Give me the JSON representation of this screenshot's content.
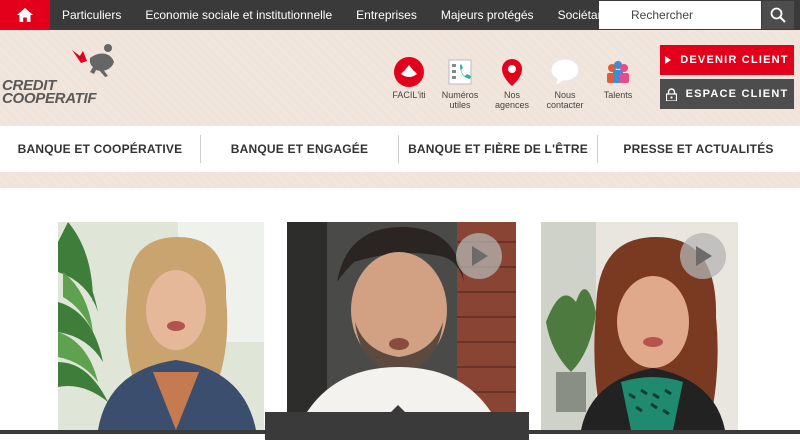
{
  "topbar": {
    "home_icon": "home-icon",
    "nav": [
      "Particuliers",
      "Economie sociale et institutionnelle",
      "Entreprises",
      "Majeurs protégés",
      "Sociétariat"
    ],
    "search_placeholder": "Rechercher",
    "search_icon": "search-icon"
  },
  "brand": {
    "logo_line1": "CREDIT",
    "logo_line2": "COOPERATIF",
    "color": "#e2001a"
  },
  "tools": [
    {
      "label": "FACIL'iti",
      "icon": "faciliti-icon"
    },
    {
      "label": "Numéros utiles",
      "line1": "Numéros",
      "line2": "utiles",
      "icon": "phone-list-icon"
    },
    {
      "label": "Nos agences",
      "line1": "Nos",
      "line2": "agences",
      "icon": "map-pin-icon"
    },
    {
      "label": "Nous contacter",
      "line1": "Nous",
      "line2": "contacter",
      "icon": "chat-bubble-icon"
    },
    {
      "label": "Talents",
      "icon": "people-icon"
    }
  ],
  "cta": {
    "become_client": "DEVENIR CLIENT",
    "client_space": "ESPACE CLIENT"
  },
  "mainnav": [
    "BANQUE ET COOPÉRATIVE",
    "BANQUE ET ENGAGÉE",
    "BANQUE ET FIÈRE DE L'ÊTRE",
    "PRESSE ET ACTUALITÉS"
  ],
  "videos": [
    {
      "name": "video-woman-blonde",
      "has_play": false
    },
    {
      "name": "video-man-curly",
      "has_play": true,
      "active": true
    },
    {
      "name": "video-woman-brunette",
      "has_play": true
    }
  ],
  "colors": {
    "accent": "#e2001a",
    "dark": "#3a3a3a",
    "cream": "#f1e6dd"
  }
}
